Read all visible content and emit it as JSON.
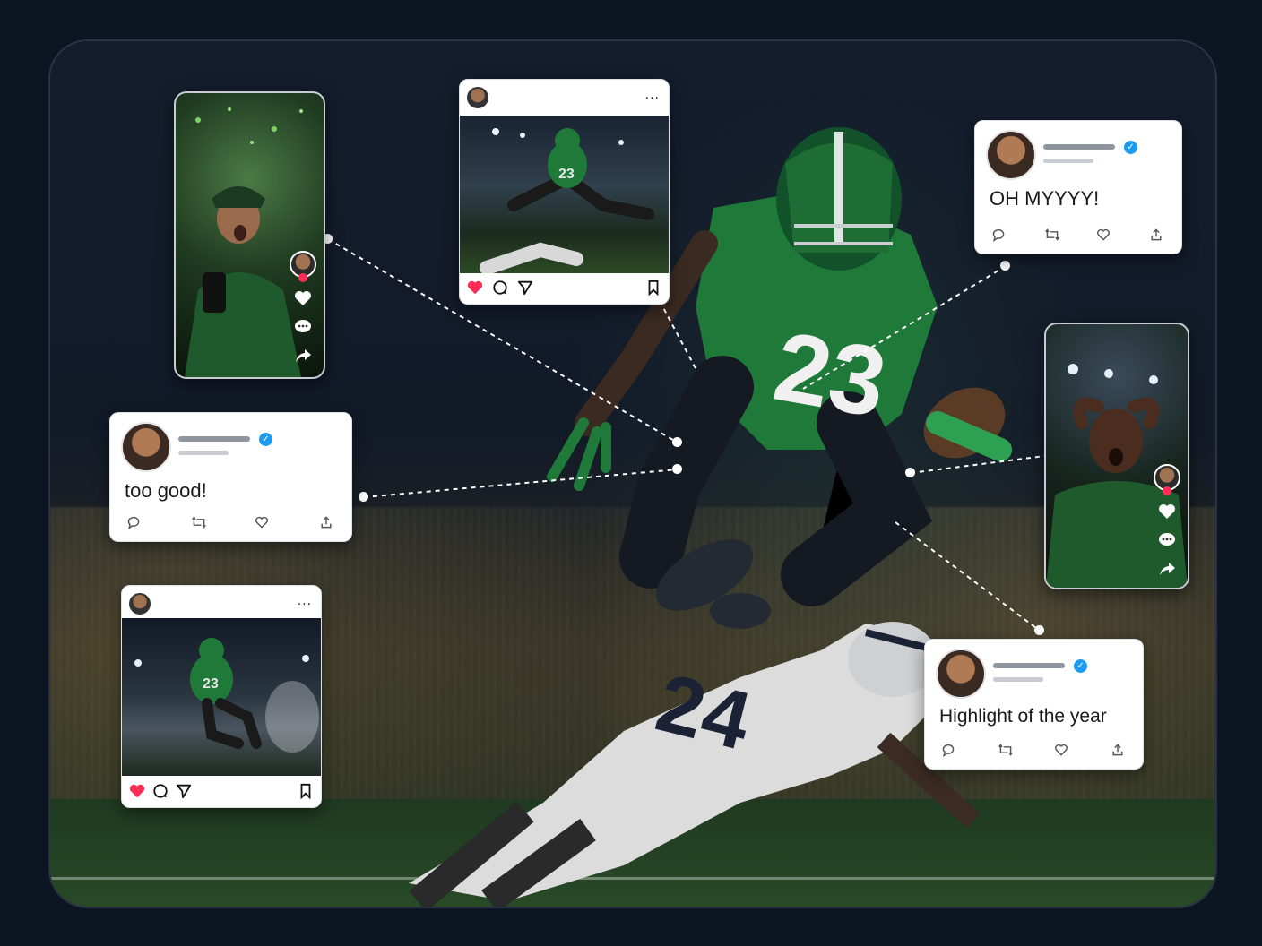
{
  "scene": {
    "main_player_number": "23",
    "tackler_number": "24",
    "colors": {
      "background": "#0d1422",
      "home_jersey": "#1f7a3a",
      "away_jersey": "#e6e6e6",
      "away_numbers": "#1b2236",
      "like": "#ff2d55",
      "verified": "#1d9bf0"
    }
  },
  "tweets": [
    {
      "text": "OH MYYYY!",
      "icons": [
        "reply-icon",
        "retweet-icon",
        "heart-icon",
        "share-icon"
      ]
    },
    {
      "text": "too good!",
      "icons": [
        "reply-icon",
        "retweet-icon",
        "heart-icon",
        "share-icon"
      ]
    },
    {
      "text": "Highlight of the year",
      "icons": [
        "reply-icon",
        "retweet-icon",
        "heart-icon",
        "share-icon"
      ]
    }
  ],
  "instagram_posts": [
    {
      "more": "...",
      "liked": true,
      "jersey_number": "23",
      "icons": [
        "heart-icon",
        "comment-icon",
        "send-icon",
        "bookmark-icon"
      ]
    },
    {
      "more": "...",
      "liked": true,
      "jersey_number": "23",
      "icons": [
        "heart-icon",
        "comment-icon",
        "send-icon",
        "bookmark-icon"
      ]
    }
  ],
  "tiktok_videos": [
    {
      "icons": [
        "avatar-follow-icon",
        "heart-icon",
        "comment-icon",
        "share-icon"
      ]
    },
    {
      "icons": [
        "avatar-follow-icon",
        "heart-icon",
        "comment-icon",
        "share-icon"
      ]
    }
  ]
}
